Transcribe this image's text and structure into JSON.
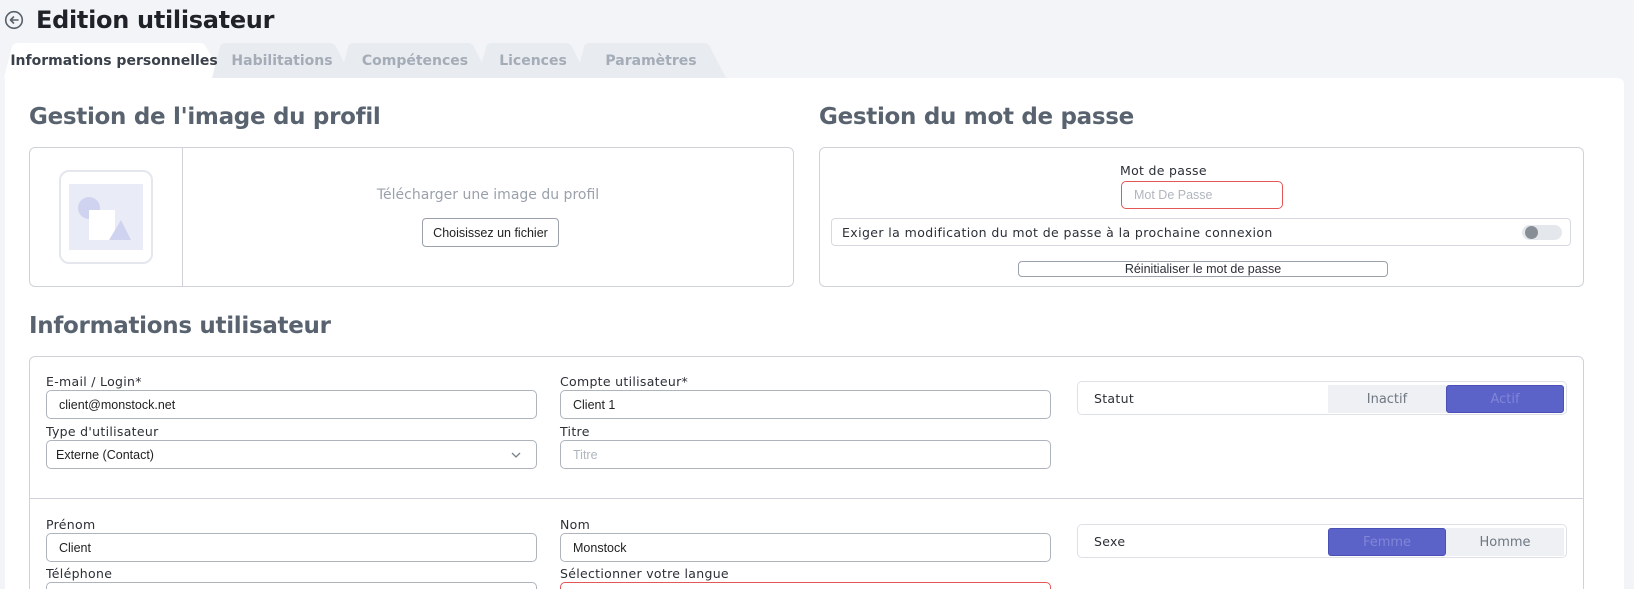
{
  "header": {
    "title": "Edition utilisateur"
  },
  "tabs": [
    {
      "label": "Informations personnelles",
      "active": true
    },
    {
      "label": "Habilitations",
      "active": false
    },
    {
      "label": "Compétences",
      "active": false
    },
    {
      "label": "Licences",
      "active": false
    },
    {
      "label": "Paramètres",
      "active": false
    }
  ],
  "profile_image": {
    "title": "Gestion de l'image du profil",
    "upload_text": "Télécharger une image du profil",
    "file_button": "Choisissez un fichier"
  },
  "password": {
    "title": "Gestion du mot de passe",
    "label": "Mot de passe",
    "placeholder": "Mot De Passe",
    "force_change_label": "Exiger la modification du mot de passe à la prochaine connexion",
    "force_change_enabled": false,
    "reset_button": "Réinitialiser le mot de passe"
  },
  "user_info": {
    "title": "Informations utilisateur",
    "email_label": "E-mail / Login*",
    "email_value": "client@monstock.net",
    "account_label": "Compte utilisateur*",
    "account_value": "Client 1",
    "user_type_label": "Type d'utilisateur",
    "user_type_value": "Externe (Contact)",
    "title_label": "Titre",
    "title_placeholder": "Titre",
    "status_label": "Statut",
    "status_options": [
      "Inactif",
      "Actif"
    ],
    "status_selected": "Actif",
    "firstname_label": "Prénom",
    "firstname_value": "Client",
    "lastname_label": "Nom",
    "lastname_value": "Monstock",
    "gender_label": "Sexe",
    "gender_options": [
      "Femme",
      "Homme"
    ],
    "gender_selected": "Femme",
    "phone_label": "Téléphone",
    "language_label": "Sélectionner votre langue"
  },
  "colors": {
    "accent": "#5b62c8",
    "error_border": "#e45757"
  }
}
